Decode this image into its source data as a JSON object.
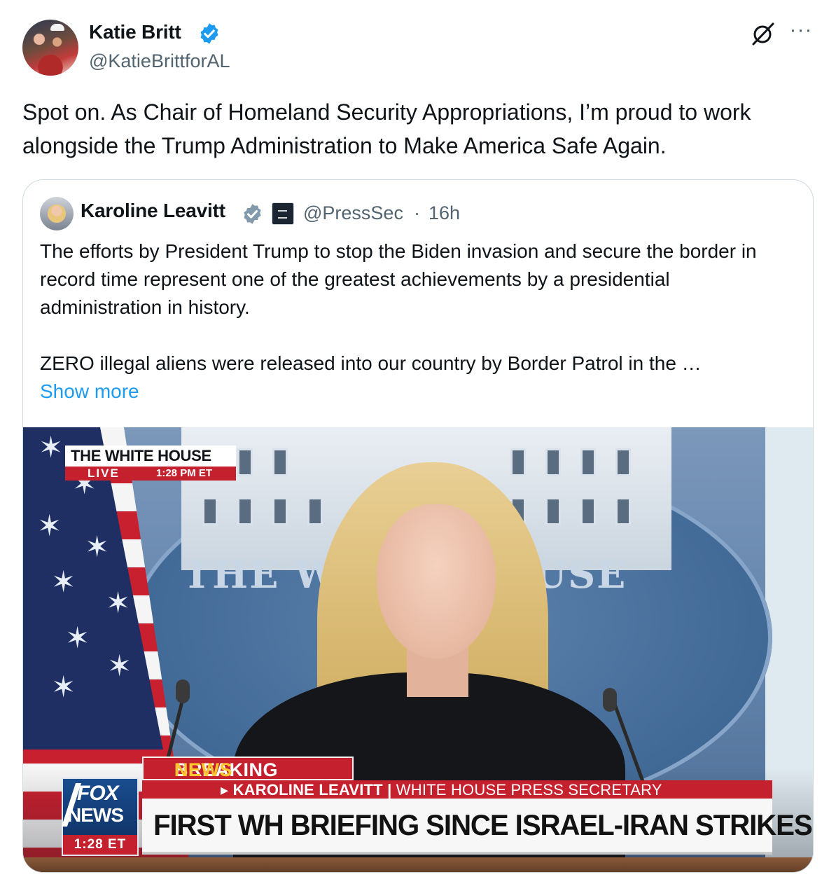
{
  "tweet": {
    "author_name": "Katie Britt",
    "author_handle": "@KatieBrittforAL",
    "more_icon": "more-icon",
    "grok_icon": "grok-icon",
    "text": "Spot on. As Chair of Homeland Security Appropriations, I’m proud to work alongside the Trump Administration to Make America Safe Again."
  },
  "quote": {
    "author_name": "Karoline Leavitt",
    "handle": "@PressSec",
    "separator": "·",
    "time": "16h",
    "text": "The efforts by President Trump to stop the Biden invasion and secure the border in record time represent one of the greatest achievements by a presidential administration in history.\n\nZERO illegal aliens were released into our country by Border Patrol in the …",
    "show_more": "Show more"
  },
  "media": {
    "bug_title": "THE WHITE HOUSE",
    "bug_live": "LIVE",
    "bug_time": "1:28 PM ET",
    "seal_left": "THE W",
    "seal_right": "OUSE",
    "breaking_1": "BREAKING",
    "breaking_2": "NEWS",
    "name_line": "KAROLINE LEAVITT",
    "name_title": "WHITE HOUSE PRESS SECRETARY",
    "headline": "FIRST WH BRIEFING SINCE ISRAEL-IRAN STRIKES BEGAN",
    "logo_fox": "FOX",
    "logo_news": "NEWS",
    "logo_time": "1:28 ET"
  },
  "colors": {
    "link": "#1d9bf0",
    "verified": "#1d9bf0",
    "secondary_text": "#536471",
    "fox_red": "#c5202d"
  }
}
